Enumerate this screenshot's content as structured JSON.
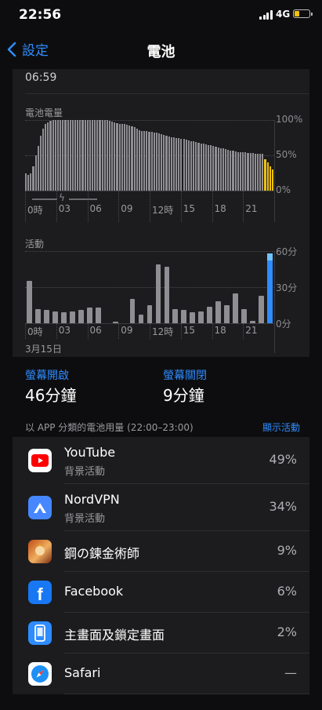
{
  "status_bar": {
    "time": "22:56",
    "network": "4G",
    "battery_level": 0.35
  },
  "nav": {
    "back_label": "設定",
    "title": "電池"
  },
  "last_charge": {
    "time": "06:59"
  },
  "battery_chart": {
    "label": "電池電量",
    "y_labels": [
      "100%",
      "50%",
      "0%"
    ],
    "x_labels": [
      "0時",
      "03",
      "06",
      "09",
      "12時",
      "15",
      "18",
      "21"
    ]
  },
  "activity_chart": {
    "label": "活動",
    "y_labels": [
      "60分",
      "30分",
      "0分"
    ],
    "x_labels": [
      "0時",
      "03",
      "06",
      "09",
      "12時",
      "15",
      "18",
      "21"
    ],
    "date": "3月15日"
  },
  "screen_stats": {
    "on_label": "螢幕開啟",
    "on_value": "46分鐘",
    "off_label": "螢幕關閉",
    "off_value": "9分鐘"
  },
  "usage": {
    "header": "以 APP 分類的電池用量 (22:00–23:00)",
    "show_activity": "顯示活動"
  },
  "apps": [
    {
      "name": "YouTube",
      "sub": "背景活動",
      "pct": "49%",
      "icon": "youtube-icon"
    },
    {
      "name": "NordVPN",
      "sub": "背景活動",
      "pct": "34%",
      "icon": "nordvpn-icon"
    },
    {
      "name": "鋼の鍊金術師",
      "sub": "",
      "pct": "9%",
      "icon": "game-icon"
    },
    {
      "name": "Facebook",
      "sub": "",
      "pct": "6%",
      "icon": "facebook-icon"
    },
    {
      "name": "主畫面及鎖定畫面",
      "sub": "",
      "pct": "2%",
      "icon": "home-screen-icon"
    },
    {
      "name": "Safari",
      "sub": "",
      "pct": "—",
      "icon": "safari-icon"
    }
  ],
  "colors": {
    "accent": "#2f8cff",
    "battery_bar": "#8e8e93",
    "battery_low": "#f4c20d",
    "activity_on": "#8e8e93",
    "activity_off": "#5a5a5e",
    "activity_current": "#2f8cff"
  },
  "chart_data": [
    {
      "type": "bar",
      "title": "電池電量",
      "ylabel": "",
      "ylim": [
        0,
        100
      ],
      "y_ticks": [
        "0%",
        "50%",
        "100%"
      ],
      "x_ticks": [
        "0時",
        "03",
        "06",
        "09",
        "12時",
        "15",
        "18",
        "21"
      ],
      "values": [
        25,
        22,
        24,
        35,
        50,
        63,
        78,
        88,
        94,
        97,
        99,
        100,
        100,
        100,
        100,
        100,
        100,
        100,
        100,
        100,
        100,
        100,
        100,
        100,
        100,
        100,
        100,
        100,
        100,
        100,
        100,
        100,
        100,
        100,
        99,
        98,
        97,
        96,
        95,
        95,
        94,
        93,
        92,
        91,
        90,
        88,
        86,
        85,
        84,
        84,
        83,
        83,
        82,
        82,
        81,
        80,
        79,
        78,
        77,
        76,
        76,
        75,
        74,
        73,
        73,
        72,
        71,
        70,
        70,
        69,
        68,
        67,
        67,
        66,
        65,
        64,
        63,
        62,
        61,
        60,
        60,
        59,
        58,
        57,
        57,
        56,
        55,
        55,
        54,
        54,
        53,
        53,
        53,
        52,
        52,
        52,
        52,
        45,
        40,
        35,
        30
      ],
      "low_battery_bars": [
        97,
        98,
        99,
        100
      ]
    },
    {
      "type": "bar",
      "title": "活動",
      "ylabel": "",
      "ylim": [
        0,
        60
      ],
      "y_ticks": [
        "0分",
        "30分",
        "60分"
      ],
      "x_ticks": [
        "0時",
        "03",
        "06",
        "09",
        "12時",
        "15",
        "18",
        "21"
      ],
      "series": [
        {
          "name": "",
          "values": [
            35,
            12,
            11,
            10,
            9,
            10,
            11,
            13,
            13,
            0,
            1,
            0,
            20,
            7,
            15,
            49,
            47,
            12,
            11,
            9,
            10,
            14,
            18,
            15,
            25,
            12,
            2,
            23,
            58
          ]
        },
        {
          "name": "",
          "values": [
            0,
            0,
            0,
            0,
            0,
            0,
            0,
            0,
            0,
            0,
            0,
            0,
            0,
            0,
            0,
            0,
            0,
            0,
            0,
            0,
            0,
            0,
            0,
            0,
            0,
            0,
            0,
            0,
            0
          ]
        }
      ]
    }
  ]
}
